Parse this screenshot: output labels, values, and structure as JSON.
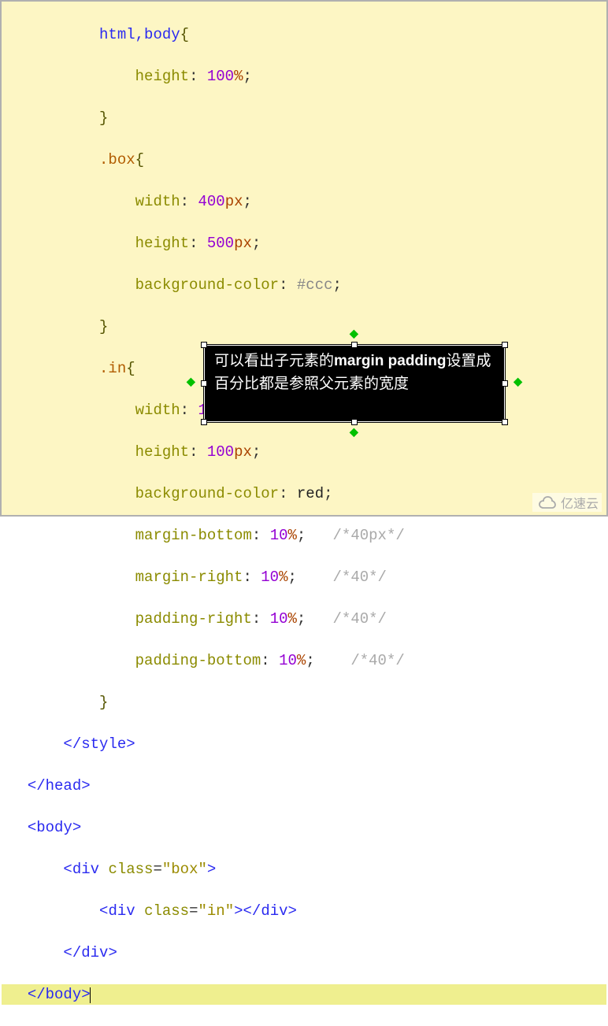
{
  "code": {
    "line1_selector": "html",
    "line1_comma": ",",
    "line1_selector2": "body",
    "open_brace": "{",
    "close_brace": "}",
    "height_prop": "height",
    "colon": ":",
    "semicolon": ";",
    "pct": "%",
    "px": "px",
    "val_100": "100",
    "val_400": "400",
    "val_500": "500",
    "val_10": "10",
    "width_prop": "width",
    "bgcolor_prop": "background-color",
    "mbottom_prop": "margin-bottom",
    "mright_prop": "margin-right",
    "pright_prop": "padding-right",
    "pbottom_prop": "padding-bottom",
    "box_selector": ".box",
    "in_selector": ".in",
    "ccc": "#ccc",
    "red": "red",
    "comment_40px": "/*40px*/",
    "comment_40": "/*40*/",
    "style_close": "</",
    "style_name": "style",
    "gt": ">",
    "head_name": "head",
    "body_name": "body",
    "div_name": "div",
    "lt": "<",
    "slash": "/",
    "class_attr": "class",
    "eq": "=",
    "box_str": "\"box\"",
    "in_str": "\"in\""
  },
  "tooltip": {
    "l1a": "可以看出子元素的",
    "l1b": "margin",
    "l2a": "padding",
    "l2b": "设置成百分比都是参照父元素的宽度"
  },
  "logo": {
    "text": "亿速云"
  }
}
